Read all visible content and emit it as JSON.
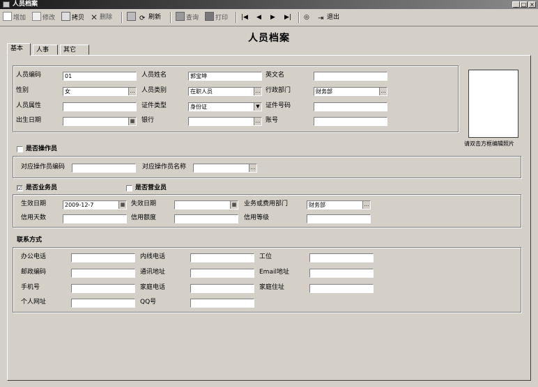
{
  "window": {
    "title": "人员档案"
  },
  "toolbar": {
    "add": "增加",
    "edit": "修改",
    "copy": "拷贝",
    "delete": "删除",
    "save": "保存",
    "refresh": "刷新",
    "query": "查询",
    "print": "打印",
    "exit": "退出"
  },
  "form": {
    "title": "人员档案",
    "tabs": [
      "基本",
      "人事",
      "其它"
    ]
  },
  "basic": {
    "code_label": "人员编码",
    "code_value": "01",
    "name_label": "人员姓名",
    "name_value": "郭宝坤",
    "en_label": "英文名",
    "gender_label": "性别",
    "gender_value": "女",
    "category_label": "人员类别",
    "category_value": "在职人员",
    "dept_label": "行政部门",
    "dept_value": "财务部",
    "id_label": "人员属性",
    "cert_type_label": "证件类型",
    "cert_type_value": "身份证",
    "cert_no_label": "证件号码",
    "birth_label": "出生日期",
    "bank_label": "银行",
    "account_label": "账号",
    "photo_hint": "请双击方框编辑照片"
  },
  "operator": {
    "check_label": "是否操作员",
    "code_label": "对应操作员编码",
    "name_label": "对应操作员名称"
  },
  "business": {
    "check_label": "是否业务员",
    "checked": "☑",
    "check2_label": "是否营业员",
    "effective_label": "生效日期",
    "effective_value": "2009-12-7",
    "expire_label": "失效日期",
    "dept_label": "业务或费用部门",
    "dept_value": "财务部",
    "credit_days_label": "信用天数",
    "credit_amount_label": "信用额度",
    "credit_level_label": "信用等级"
  },
  "contact": {
    "section_label": "联系方式",
    "office_phone": "办公电话",
    "ext_phone": "内线电话",
    "station": "工位",
    "postcode": "邮政编码",
    "address": "通讯地址",
    "email": "Email地址",
    "mobile": "手机号",
    "home_phone": "家庭电话",
    "home_address": "家庭住址",
    "homepage": "个人网址",
    "qq": "QQ号"
  }
}
